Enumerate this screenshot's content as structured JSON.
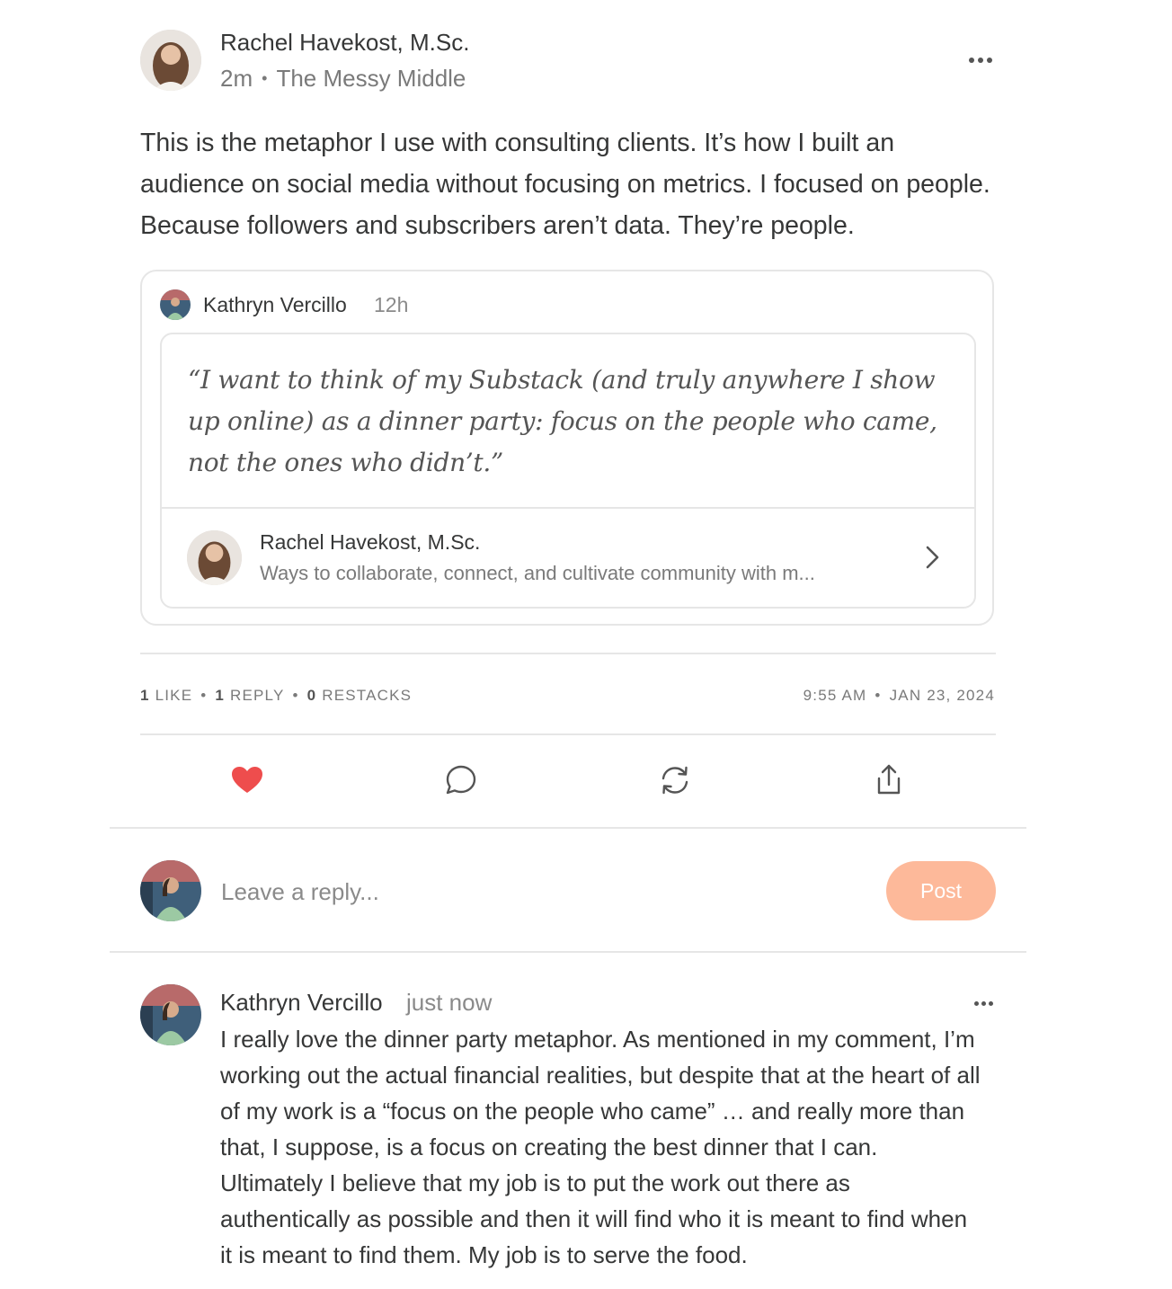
{
  "post": {
    "author": "Rachel Havekost, M.Sc.",
    "time": "2m",
    "publication": "The Messy Middle",
    "body": "This is the metaphor I use with consulting clients. It’s how I built an audience on social media without focusing on metrics. I focused on people. Because followers and subscribers aren’t data. They’re people."
  },
  "quoted": {
    "author": "Kathryn Vercillo",
    "time": "12h",
    "quote": "“I want to think of my Substack (and truly anywhere I show up online) as a dinner party: focus on the people who came, not the ones who didn’t.”",
    "publication_name": "Rachel Havekost, M.Sc.",
    "publication_desc": "Ways to collaborate, connect, and cultivate community with m..."
  },
  "stats": {
    "likes": "1",
    "likes_label": "LIKE",
    "replies": "1",
    "replies_label": "REPLY",
    "restacks": "0",
    "restacks_label": "RESTACKS",
    "time": "9:55 AM",
    "date": "JAN 23, 2024"
  },
  "actions": {
    "like_icon": "heart-icon",
    "comment_icon": "comment-icon",
    "restack_icon": "restack-icon",
    "share_icon": "share-icon",
    "like_color": "#ee4d4d"
  },
  "reply_box": {
    "placeholder": "Leave a reply...",
    "post_label": "Post",
    "post_color": "#fdb99a"
  },
  "comment": {
    "author": "Kathryn Vercillo",
    "time": "just now",
    "text": "I really love the dinner party metaphor. As mentioned in my comment, I’m working out the actual financial realities, but despite that at the heart of all of my work is a “focus on the people who came” … and really more than that, I suppose, is a focus on creating the best dinner that I can. Ultimately I believe that my job is to put the work out there as authentically as possible and then it will find who it is meant to find when it is meant to find them. My job is to serve the food."
  }
}
